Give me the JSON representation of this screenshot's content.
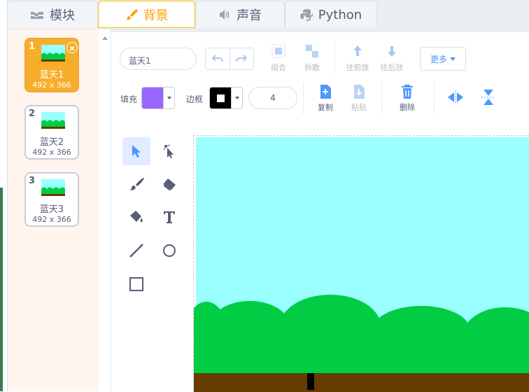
{
  "tabs": [
    {
      "label": "模块",
      "icon": "code-blocks-icon"
    },
    {
      "label": "背景",
      "icon": "paint-brush-icon"
    },
    {
      "label": "声音",
      "icon": "speaker-icon"
    },
    {
      "label": "Python",
      "icon": "python-icon"
    }
  ],
  "costumes": [
    {
      "number": "1",
      "name": "蓝天1",
      "size": "492 x 366",
      "selected": true
    },
    {
      "number": "2",
      "name": "蓝天2",
      "size": "492 x 366",
      "selected": false
    },
    {
      "number": "3",
      "name": "蓝天3",
      "size": "492 x 366",
      "selected": false
    }
  ],
  "editor": {
    "costume_name": "蓝天1",
    "group_label": "组合",
    "ungroup_label": "拆散",
    "forward_label": "往前放",
    "backward_label": "往后放",
    "more_label": "更多",
    "fill_label": "填充",
    "outline_label": "边框",
    "outline_width": "4",
    "copy_label": "复制",
    "paste_label": "粘贴",
    "delete_label": "删除"
  },
  "colors": {
    "accent": "#ff9f00",
    "fill": "#9966ff",
    "outline": "#000000",
    "sky": "#99ffff",
    "bushes": "#00cc44",
    "ground": "#663c00",
    "toolbar_icon": "#4c97ff",
    "delete_icon": "#4c97ff"
  },
  "tools": [
    "select-tool",
    "reshape-tool",
    "brush-tool",
    "eraser-tool",
    "fill-tool",
    "text-tool",
    "line-tool",
    "circle-tool",
    "rectangle-tool"
  ]
}
